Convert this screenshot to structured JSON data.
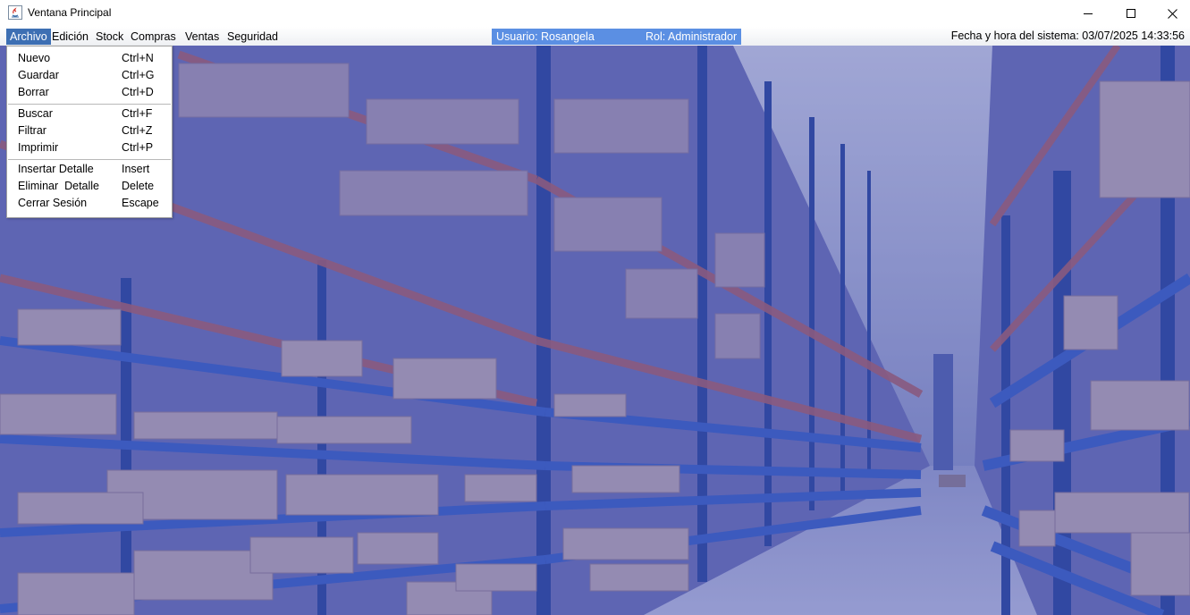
{
  "window": {
    "title": "Ventana Principal",
    "controls": {
      "minimize": "minimize-icon",
      "maximize": "maximize-icon",
      "close": "close-icon"
    }
  },
  "menubar": {
    "items": [
      {
        "label": "Archivo",
        "active": true
      },
      {
        "label": "Edición"
      },
      {
        "label": "Stock"
      },
      {
        "label": "Compras"
      },
      {
        "label": "Ventas"
      },
      {
        "label": "Seguridad"
      }
    ]
  },
  "session": {
    "user": "Usuario: Rosangela",
    "role": "Rol: Administrador",
    "datetime": "Fecha y hora del sistema: 03/07/2025 14:33:56"
  },
  "archivo_menu": {
    "items": [
      {
        "label": "Nuevo",
        "accel": "Ctrl+N"
      },
      {
        "label": "Guardar",
        "accel": "Ctrl+G"
      },
      {
        "label": "Borrar",
        "accel": "Ctrl+D"
      },
      {
        "label": "Buscar",
        "accel": "Ctrl+F"
      },
      {
        "label": "Filtrar",
        "accel": "Ctrl+Z"
      },
      {
        "label": "Imprimir",
        "accel": "Ctrl+P"
      },
      {
        "label": "Insertar Detalle",
        "accel": "Insert"
      },
      {
        "label": "Eliminar  Detalle",
        "accel": "Delete"
      },
      {
        "label": "Cerrar Sesión",
        "accel": "Escape"
      }
    ]
  },
  "colors": {
    "menu_active": "#3d6fb3",
    "userbox": "#5b8fe3",
    "overlay": "#4a55a8"
  }
}
